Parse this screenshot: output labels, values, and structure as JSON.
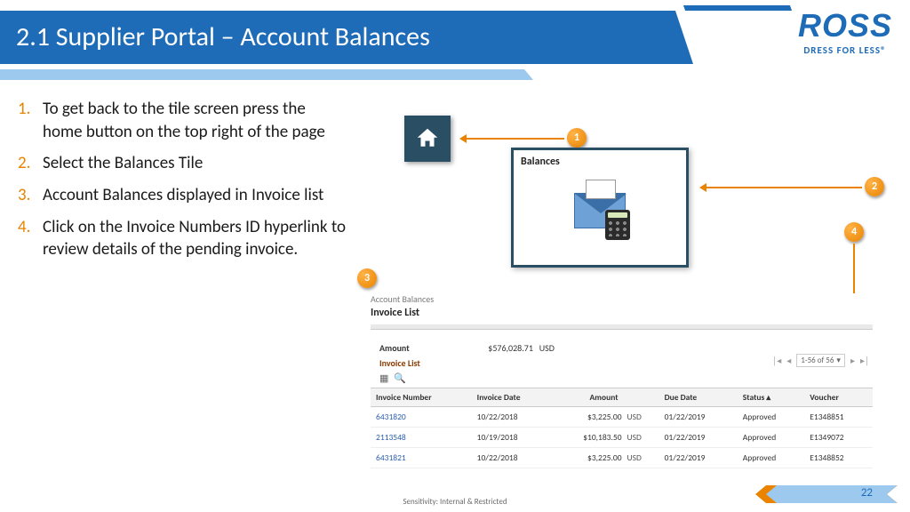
{
  "header": {
    "title": "2.1 Supplier Portal – Account Balances",
    "logo_main": "ROSS",
    "logo_sub": "DRESS FOR LESS®"
  },
  "instructions": [
    "To get back to the tile screen press the home button on the top right of the page",
    "Select the Balances Tile",
    "Account Balances displayed in Invoice list",
    "Click on the Invoice Numbers ID hyperlink to review details of the pending invoice."
  ],
  "tile": {
    "title": "Balances"
  },
  "markers": {
    "m1": "1",
    "m2": "2",
    "m3": "3",
    "m4": "4"
  },
  "invoice_panel": {
    "breadcrumb": "Account Balances",
    "title": "Invoice List",
    "amount_label": "Amount",
    "amount_value": "$576,028.71",
    "amount_currency": "USD",
    "section_label": "Invoice List",
    "pager_text": "1-56 of 56",
    "columns": [
      "Invoice Number",
      "Invoice Date",
      "Amount",
      "",
      "Due Date",
      "Status ▴",
      "Voucher"
    ],
    "rows": [
      {
        "num": "6431820",
        "date": "10/22/2018",
        "amount": "$3,225.00",
        "cur": "USD",
        "due": "01/22/2019",
        "status": "Approved",
        "voucher": "E1348851"
      },
      {
        "num": "2113548",
        "date": "10/19/2018",
        "amount": "$10,183.50",
        "cur": "USD",
        "due": "01/22/2019",
        "status": "Approved",
        "voucher": "E1349072"
      },
      {
        "num": "6431821",
        "date": "10/22/2018",
        "amount": "$3,225.00",
        "cur": "USD",
        "due": "01/22/2019",
        "status": "Approved",
        "voucher": "E1348852"
      }
    ]
  },
  "footer": {
    "sensitivity": "Sensitivity: Internal & Restricted",
    "page_number": "22"
  }
}
